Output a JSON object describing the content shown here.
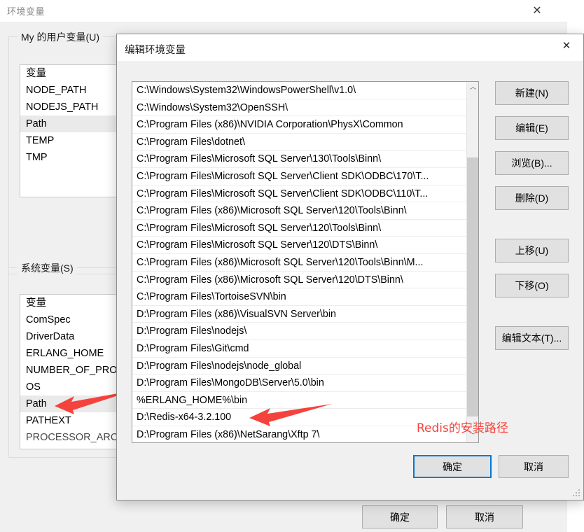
{
  "background_window": {
    "title": "环境变量",
    "close_label": "✕",
    "user_vars_group": {
      "legend": "My 的用户变量(U)",
      "column_header": "变量",
      "items": [
        {
          "name": "NODE_PATH",
          "selected": false
        },
        {
          "name": "NODEJS_PATH",
          "selected": false
        },
        {
          "name": "Path",
          "selected": true
        },
        {
          "name": "TEMP",
          "selected": false
        },
        {
          "name": "TMP",
          "selected": false
        }
      ]
    },
    "system_vars_group": {
      "legend": "系统变量(S)",
      "column_header": "变量",
      "items": [
        {
          "name": "ComSpec",
          "selected": false
        },
        {
          "name": "DriverData",
          "selected": false
        },
        {
          "name": "ERLANG_HOME",
          "selected": false
        },
        {
          "name": "NUMBER_OF_PRO",
          "selected": false
        },
        {
          "name": "OS",
          "selected": false
        },
        {
          "name": "Path",
          "selected": true
        },
        {
          "name": "PATHEXT",
          "selected": false
        },
        {
          "name": "PROCESSOR_ARCH",
          "selected": false
        }
      ]
    },
    "ok_label": "确定",
    "cancel_label": "取消"
  },
  "dialog": {
    "title": "编辑环境变量",
    "close_label": "✕",
    "path_entries": [
      "C:\\Windows\\System32\\WindowsPowerShell\\v1.0\\",
      "C:\\Windows\\System32\\OpenSSH\\",
      "C:\\Program Files (x86)\\NVIDIA Corporation\\PhysX\\Common",
      "C:\\Program Files\\dotnet\\",
      "C:\\Program Files\\Microsoft SQL Server\\130\\Tools\\Binn\\",
      "C:\\Program Files\\Microsoft SQL Server\\Client SDK\\ODBC\\170\\T...",
      "C:\\Program Files\\Microsoft SQL Server\\Client SDK\\ODBC\\110\\T...",
      "C:\\Program Files (x86)\\Microsoft SQL Server\\120\\Tools\\Binn\\",
      "C:\\Program Files\\Microsoft SQL Server\\120\\Tools\\Binn\\",
      "C:\\Program Files\\Microsoft SQL Server\\120\\DTS\\Binn\\",
      "C:\\Program Files (x86)\\Microsoft SQL Server\\120\\Tools\\Binn\\M...",
      "C:\\Program Files (x86)\\Microsoft SQL Server\\120\\DTS\\Binn\\",
      "C:\\Program Files\\TortoiseSVN\\bin",
      "D:\\Program Files (x86)\\VisualSVN Server\\bin",
      "D:\\Program Files\\nodejs\\",
      "D:\\Program Files\\Git\\cmd",
      "D:\\Program Files\\nodejs\\node_global",
      "D:\\Program Files\\MongoDB\\Server\\5.0\\bin",
      "%ERLANG_HOME%\\bin",
      "D:\\Redis-x64-3.2.100",
      "D:\\Program Files (x86)\\NetSarang\\Xftp 7\\",
      ""
    ],
    "side_buttons": [
      {
        "label": "新建(N)"
      },
      {
        "label": "编辑(E)"
      },
      {
        "label": "浏览(B)..."
      },
      {
        "label": "删除(D)"
      },
      {
        "label": "上移(U)"
      },
      {
        "label": "下移(O)"
      },
      {
        "label": "编辑文本(T)..."
      }
    ],
    "ok_label": "确定",
    "cancel_label": "取消",
    "scrollbar": {
      "up_label": "︿",
      "down_label": "﹀"
    }
  },
  "annotations": {
    "redis_note": "Redis的安装路径",
    "color": "#f4433c"
  }
}
